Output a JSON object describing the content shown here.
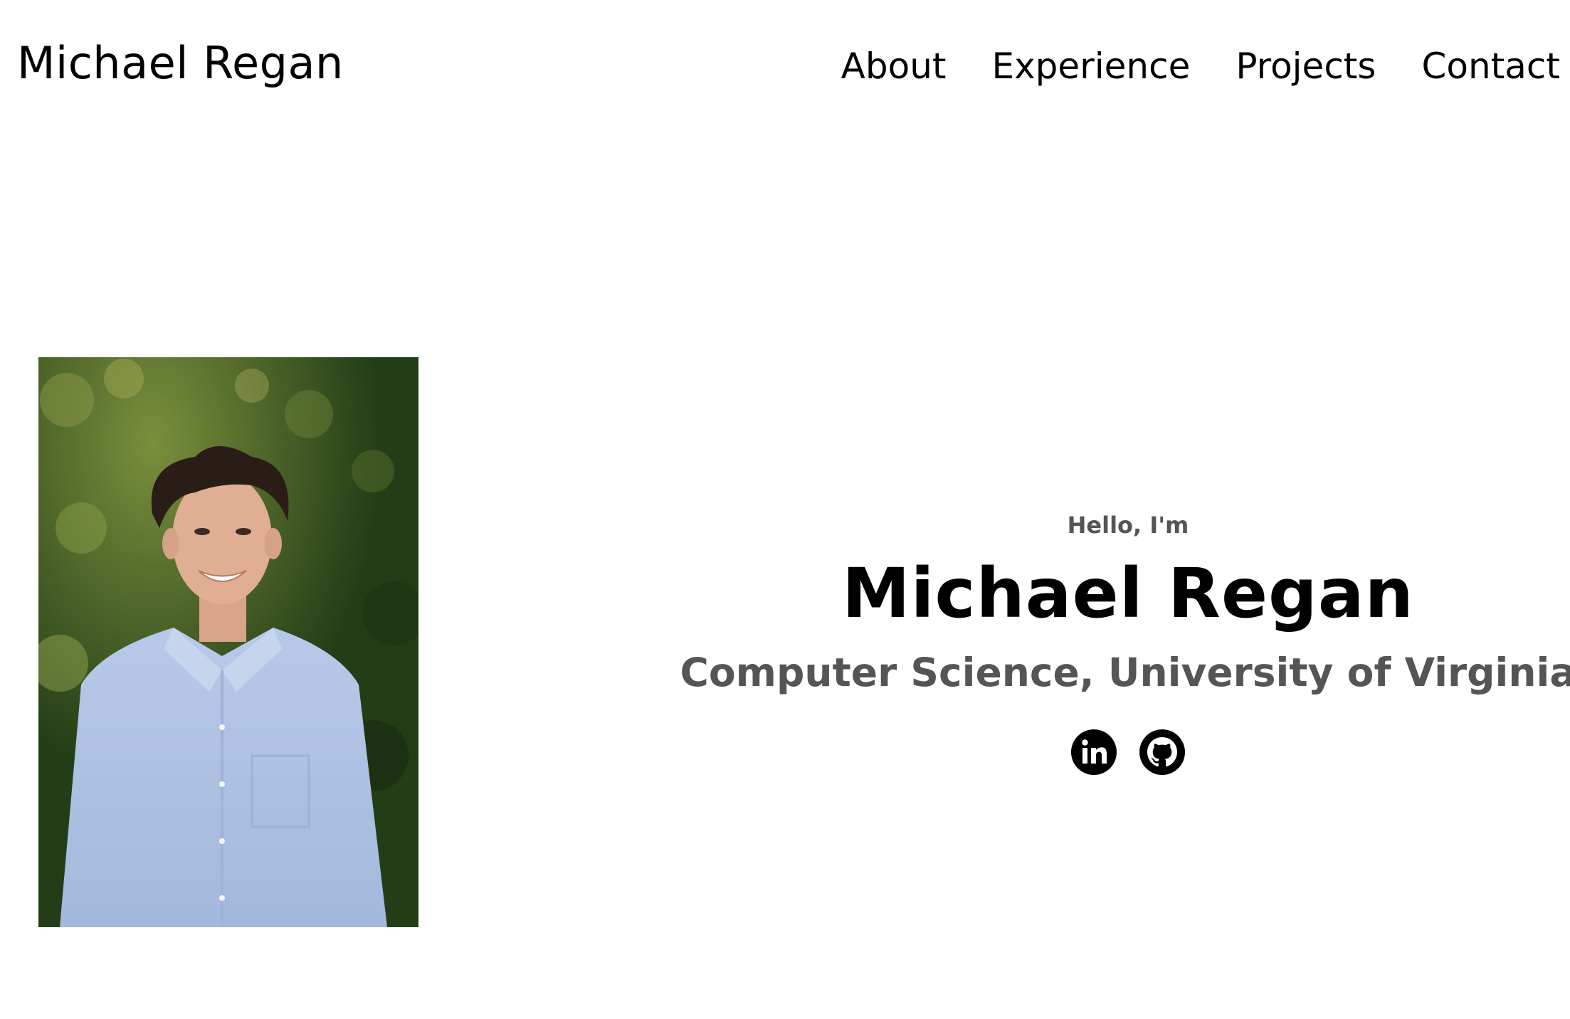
{
  "header": {
    "logo_text": "Michael Regan",
    "nav": [
      {
        "label": "About"
      },
      {
        "label": "Experience"
      },
      {
        "label": "Projects"
      },
      {
        "label": "Contact"
      }
    ]
  },
  "hero": {
    "greeting": "Hello, I'm",
    "name": "Michael Regan",
    "subtitle": "Computer Science, University of Virginia",
    "photo_alt": "Profile picture",
    "socials": [
      {
        "icon": "linkedin-icon",
        "label": "LinkedIn profile"
      },
      {
        "icon": "github-icon",
        "label": "Github profile"
      }
    ]
  },
  "colors": {
    "text": "#000000",
    "muted": "#555555",
    "background": "#ffffff"
  }
}
